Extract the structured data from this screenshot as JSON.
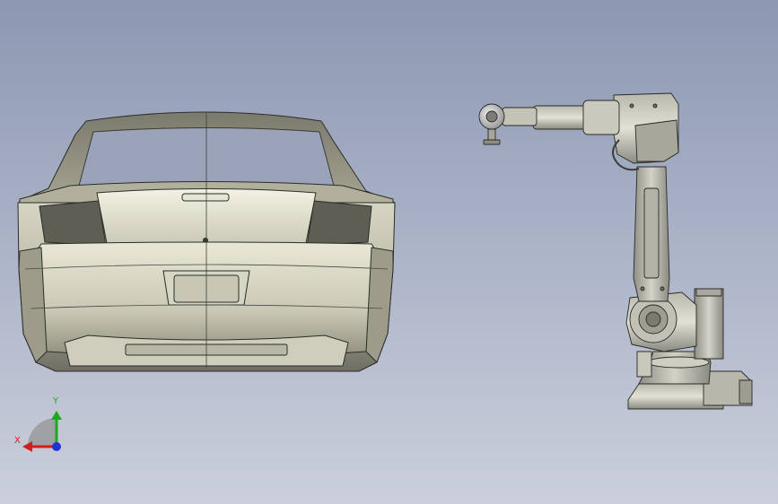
{
  "viewport": {
    "background_top": "#8c98b2",
    "background_bottom": "#cbcfdb"
  },
  "scene": {
    "objects": [
      "car-body-rear-view",
      "industrial-robot-arm"
    ]
  },
  "triad": {
    "x_label": "X",
    "y_label": "Y",
    "x_color": "#d41c1c",
    "y_color": "#1ea81e",
    "z_color": "#1f33d8"
  }
}
